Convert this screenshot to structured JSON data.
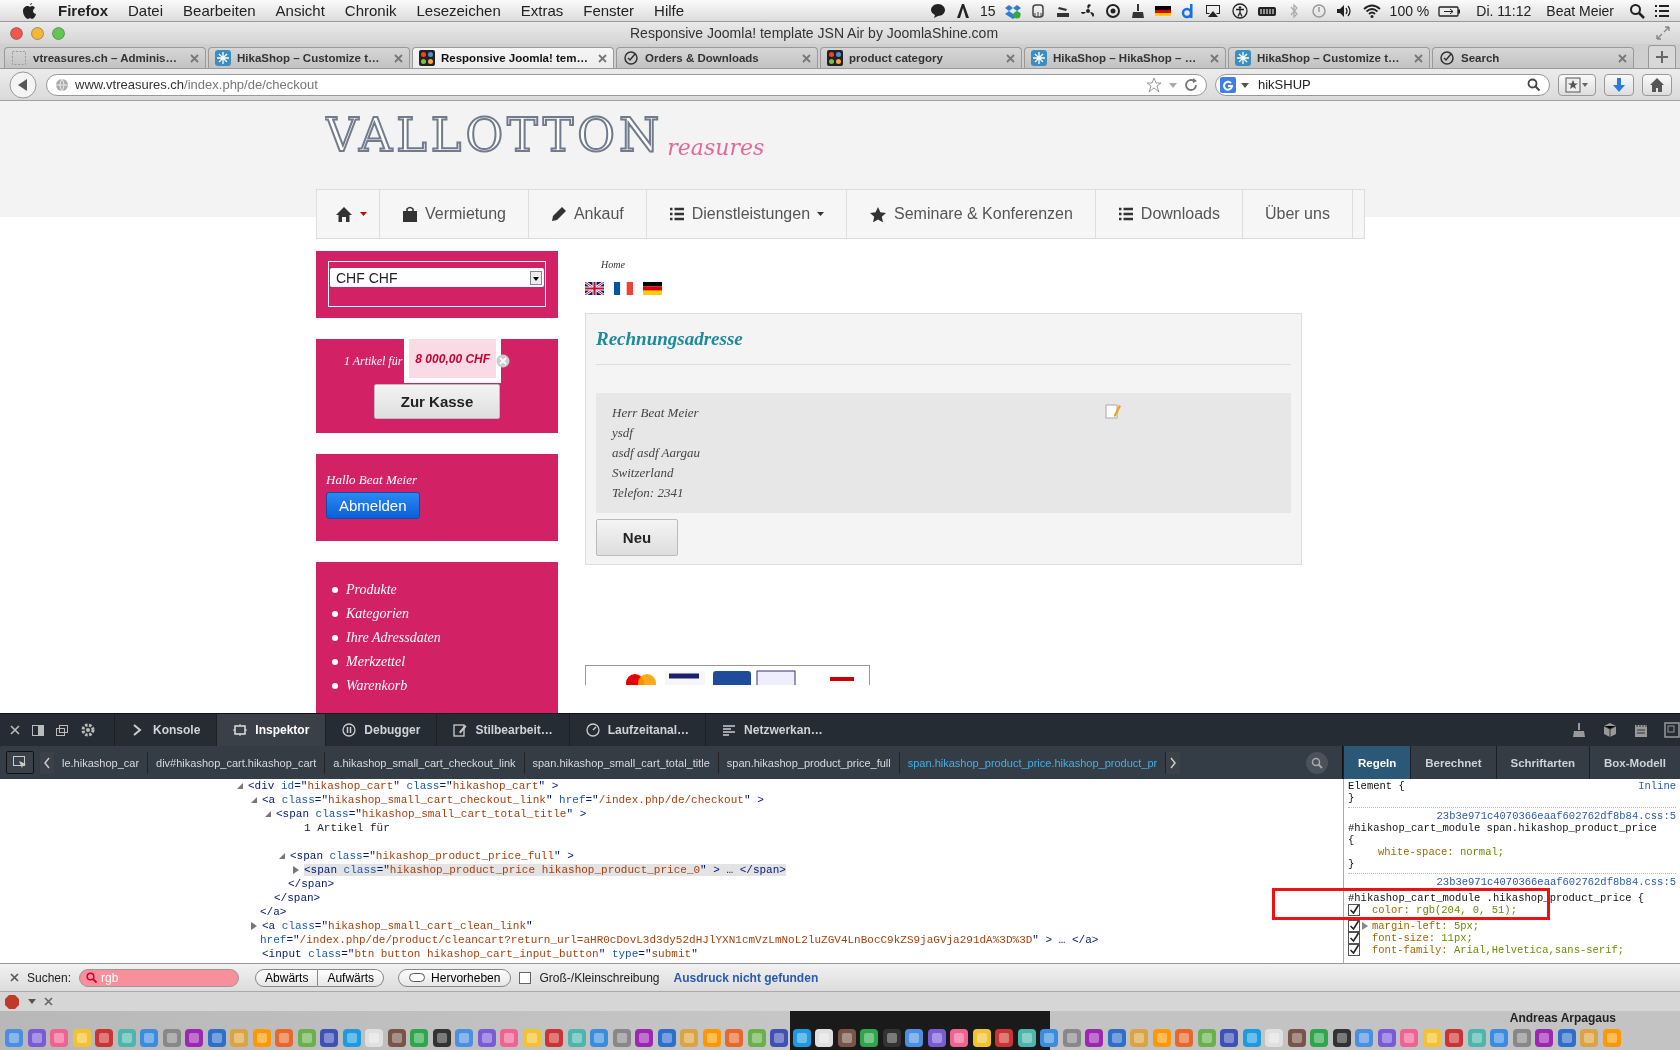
{
  "menu_bar": {
    "app": "Firefox",
    "items": [
      "Datei",
      "Bearbeiten",
      "Ansicht",
      "Chronik",
      "Lesezeichen",
      "Extras",
      "Fenster",
      "Hilfe"
    ],
    "count": "15",
    "battery": "100 %",
    "clock": "Di. 11:12",
    "user": "Beat Meier"
  },
  "window": {
    "title": "Responsive Joomla! template JSN Air by JoomlaShine.com"
  },
  "tabs": [
    {
      "label": "vtreasures.ch – Adminis…",
      "kind": "blank",
      "selected": false
    },
    {
      "label": "HikaShop – Customize t…",
      "kind": "hika",
      "selected": false
    },
    {
      "label": "Responsive Joomla! tem…",
      "kind": "joomla",
      "selected": true
    },
    {
      "label": "Orders & Downloads",
      "kind": "check",
      "selected": false
    },
    {
      "label": "product category",
      "kind": "joomla",
      "selected": false
    },
    {
      "label": "HikaShop – HikaShop – …",
      "kind": "hika",
      "selected": false
    },
    {
      "label": "HikaShop – Customize t…",
      "kind": "hika",
      "selected": false
    },
    {
      "label": "Search",
      "kind": "check",
      "selected": false
    }
  ],
  "toolbar": {
    "url_host": "www.vtreasures.ch",
    "url_path": "/index.php/de/checkout",
    "search": "hikSHUP"
  },
  "page": {
    "logo": {
      "name": "VALLOTTON",
      "tagline": "reasures"
    },
    "nav": [
      {
        "kind": "home",
        "caret": true
      },
      {
        "label": "Vermietung",
        "kind": "bag",
        "caret": false
      },
      {
        "label": "Ankauf",
        "kind": "pencil",
        "caret": false
      },
      {
        "label": "Dienstleistungen",
        "kind": "list",
        "caret": true
      },
      {
        "label": "Seminare & Konferenzen",
        "kind": "star",
        "caret": false
      },
      {
        "label": "Downloads",
        "kind": "list",
        "caret": false
      },
      {
        "label": "Über uns",
        "kind": "text",
        "caret": false
      }
    ],
    "currency": "CHF CHF",
    "cart": {
      "summary": "1 Artikel für",
      "price": "8 000,00 CHF",
      "button": "Zur Kasse"
    },
    "login": {
      "greeting": "Hallo Beat Meier",
      "button": "Abmelden"
    },
    "menu": [
      "Produkte",
      "Kategorien",
      "Ihre Adressdaten",
      "Merkzettel",
      "Warenkorb"
    ],
    "breadcrumb": "Home",
    "billing": {
      "title": "Rechnungsadresse",
      "lines": [
        "Herr Beat Meier",
        "ysdf",
        "asdf asdf Aargau",
        "Switzerland",
        "Telefon: 2341"
      ],
      "button": "Neu"
    }
  },
  "devtools": {
    "tools": [
      {
        "label": "Konsole",
        "kind": "console",
        "selected": false
      },
      {
        "label": "Inspektor",
        "kind": "inspector",
        "selected": true
      },
      {
        "label": "Debugger",
        "kind": "pause",
        "selected": false
      },
      {
        "label": "Stilbearbeit…",
        "kind": "edit",
        "selected": false
      },
      {
        "label": "Laufzeitanal…",
        "kind": "gauge",
        "selected": false
      },
      {
        "label": "Netzwerkan…",
        "kind": "lines",
        "selected": false
      }
    ],
    "breadcrumbs": [
      {
        "label": "le.hikashop_car",
        "selected": false
      },
      {
        "label": "div#hikashop_cart.hikashop_cart",
        "selected": false
      },
      {
        "label": "a.hikashop_small_cart_checkout_link",
        "selected": false
      },
      {
        "label": "span.hikashop_small_cart_total_title",
        "selected": false
      },
      {
        "label": "span.hikashop_product_price_full",
        "selected": false
      },
      {
        "label": "span.hikashop_product_price.hikashop_product_pr",
        "selected": true
      }
    ],
    "side_tabs": [
      {
        "label": "Regeln",
        "selected": true
      },
      {
        "label": "Berechnet",
        "selected": false
      },
      {
        "label": "Schriftarten",
        "selected": false
      },
      {
        "label": "Box-Modell",
        "selected": false
      }
    ],
    "markup": [
      {
        "kind": "element",
        "markup": "<div id=\"hikashop_cart\" class=\"hikashop_cart\" >",
        "expanded": true,
        "selected": false,
        "children": [
          {
            "kind": "element",
            "markup": "<a class=\"hikashop_small_cart_checkout_link\" href=\"/index.php/de/checkout\" >",
            "expanded": true,
            "selected": false,
            "close": "</a>",
            "children": [
              {
                "kind": "element",
                "markup": "<span class=\"hikashop_small_cart_total_title\" >",
                "expanded": true,
                "selected": false,
                "close": "</span>",
                "children": [
                  {
                    "kind": "text",
                    "markup": "1 Artikel für",
                    "selected": false
                  },
                  {
                    "kind": "element",
                    "markup": "<span class=\"hikashop_product_price_full\" >",
                    "expanded": true,
                    "selected": false,
                    "close": "</span>",
                    "children": [
                      {
                        "kind": "element",
                        "markup": "<span class=\"hikashop_product_price hikashop_product_price_0\" > … </span>",
                        "expanded": false,
                        "selected": true
                      }
                    ]
                  }
                ]
              }
            ]
          },
          {
            "kind": "element",
            "markup": "<a class=\"hikashop_small_cart_clean_link\"",
            "continuation": "href=\"/index.php/de/product/cleancart?return_url=aHR0cDovL3d3dy52dHJlYXN1cmVzLmNoL2luZGV4LnBocC9kZS9jaGVja291dA%3D%3D\" > … </a>",
            "expanded": false,
            "selected": false
          },
          {
            "kind": "leaf",
            "markup": "<input class=\"btn button hikashop_cart_input_button\" type=\"submit\"",
            "selected": false
          }
        ]
      }
    ],
    "rules": [
      {
        "header_lines": [
          "Element {"
        ],
        "source": "Inline",
        "close": "}"
      },
      {
        "source": "23b3e971c4070366eaaf602762df8b84.css:5",
        "header_lines": [
          "#hikashop_cart_module span.hikashop_product_price",
          "{"
        ],
        "declarations": [
          {
            "property": "white-space:",
            "value": "normal;"
          }
        ],
        "close": "}"
      },
      {
        "source": "23b3e971c4070366eaaf602762df8b84.css:5",
        "header_lines": [
          "#hikashop_cart_module .hikashop_product_price {"
        ],
        "annotated": true,
        "declarations": [
          {
            "property": "color:",
            "value": "rgb(204, 0, 51);",
            "checked": true,
            "expandable": false
          },
          {
            "property": "margin-left:",
            "value": "5px;",
            "checked": true,
            "expandable": true
          },
          {
            "property": "font-size:",
            "value": "11px;",
            "checked": true,
            "expandable": false
          },
          {
            "property": "font-family:",
            "value": "Arial,Helvetica,sans-serif;",
            "checked": true,
            "expandable": false
          }
        ]
      }
    ],
    "find": {
      "label": "Suchen:",
      "value": "rgb",
      "not_found": true,
      "buttons": [
        "Abwärts",
        "Aufwärts"
      ],
      "highlight": "Hervorheben",
      "case_label": "Groß-/Kleinschreibung",
      "case_sensitive": false,
      "message": "Ausdruck nicht gefunden"
    }
  },
  "dock": {
    "notification": "Andreas Arpagaus"
  }
}
